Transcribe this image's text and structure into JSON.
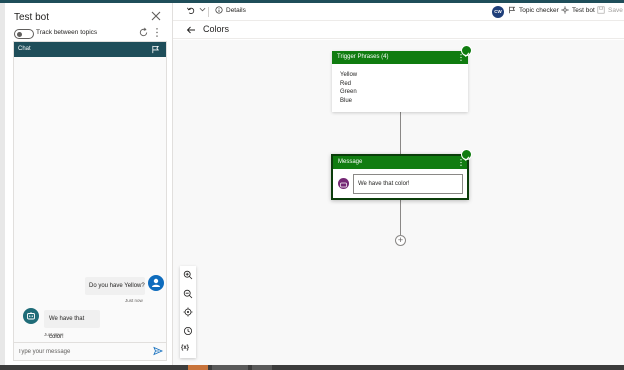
{
  "bot_panel": {
    "title": "Test bot",
    "track_label": "Track between topics",
    "chat_tab": "Chat",
    "messages": [
      {
        "from": "user",
        "text": "Do you have Yellow?",
        "time": "Just now"
      },
      {
        "from": "bot",
        "text": "We have that color!",
        "time": "Just now"
      }
    ],
    "input_placeholder": "Type your message"
  },
  "toolbar": {
    "details_label": "Details",
    "avatar_initials": "CW",
    "topic_checker_label": "Topic checker",
    "test_bot_label": "Test bot",
    "save_label": "Save"
  },
  "page": {
    "title": "Colors"
  },
  "canvas": {
    "trigger_node": {
      "title": "Trigger Phrases (4)",
      "phrases": [
        "Yellow",
        "Red",
        "Green",
        "Blue"
      ]
    },
    "message_node": {
      "title": "Message",
      "text": "We have that color!"
    },
    "add_node_label": "+",
    "zoom_tools": {
      "variables_label": "{x}"
    }
  },
  "colors": {
    "brand_dark": "#1f4e5a",
    "node_green": "#107c10",
    "user_avatar": "#0f6cbd",
    "message_icon": "#742774"
  }
}
